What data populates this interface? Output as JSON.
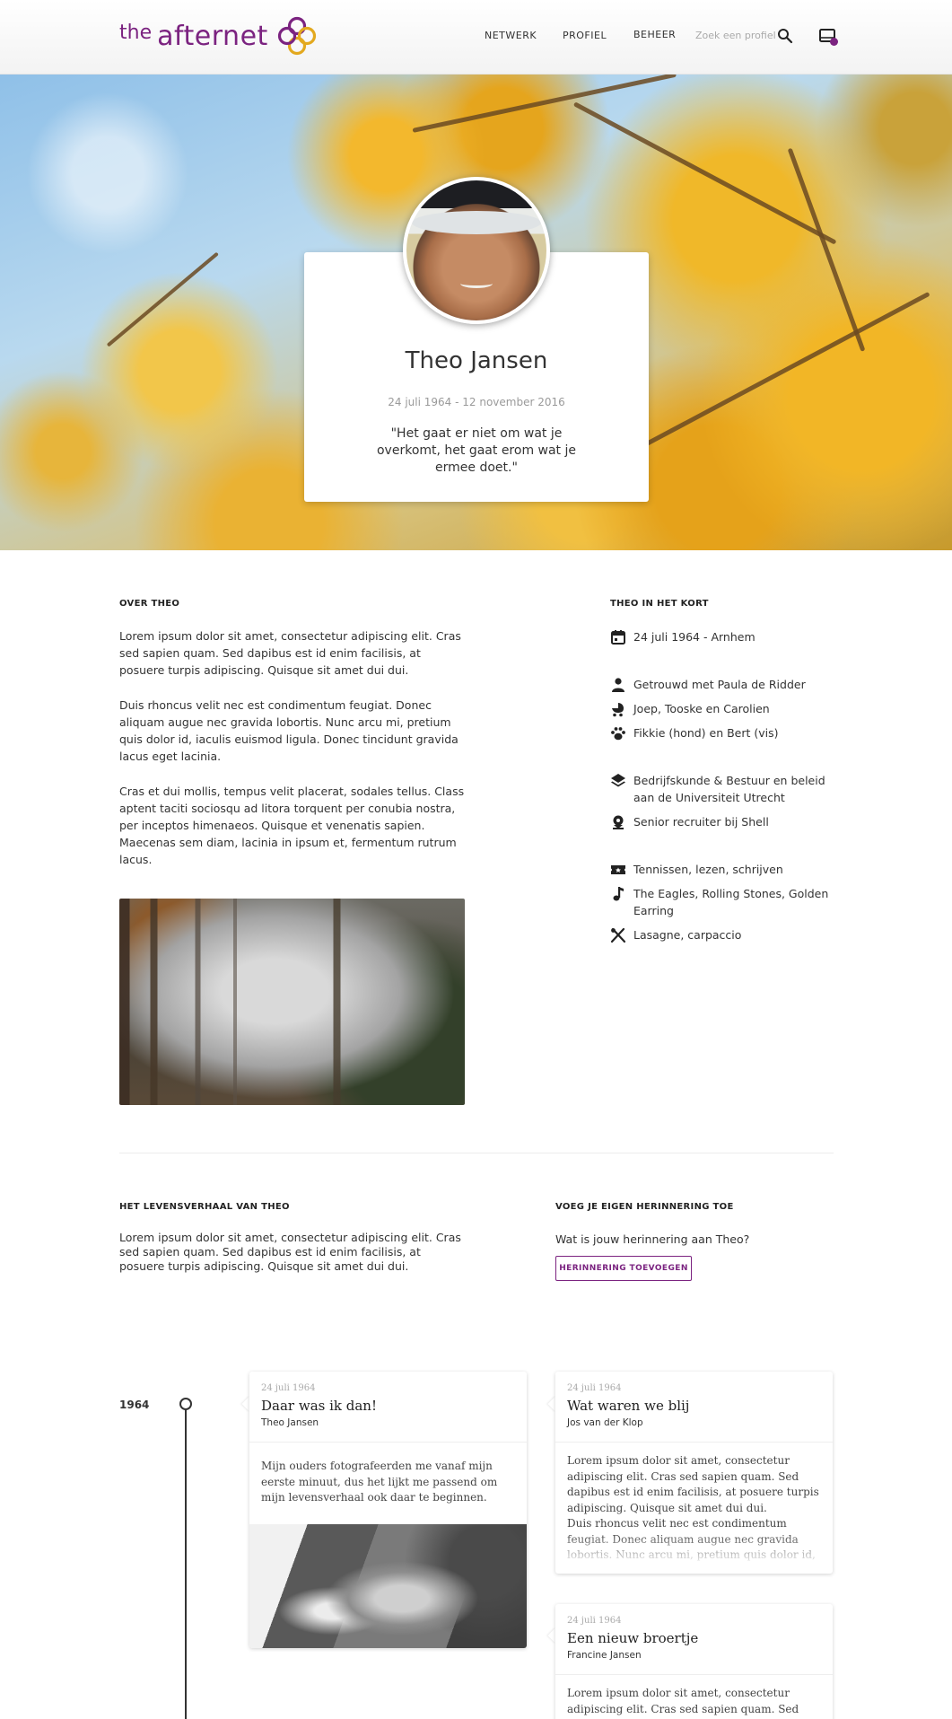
{
  "header": {
    "logo_the": "the",
    "logo_afternet": "afternet",
    "nav": [
      "NETWERK",
      "PROFIEL",
      "BEHEER"
    ],
    "search_placeholder": "Zoek een profiel",
    "brand_color": "#7b2380"
  },
  "profile": {
    "name": "Theo Jansen",
    "dates": "24 juli 1964 - 12 november 2016",
    "quote": "\"Het gaat er niet om wat je overkomt, het gaat erom wat je ermee doet.\""
  },
  "about": {
    "heading": "OVER THEO",
    "paragraphs": [
      "Lorem ipsum dolor sit amet, consectetur adipiscing elit. Cras sed sapien quam. Sed dapibus est id enim facilisis, at posuere turpis adipiscing. Quisque sit amet dui dui.",
      "Duis rhoncus velit nec est condimentum feugiat. Donec aliquam augue nec gravida lobortis. Nunc arcu mi, pretium quis dolor id, iaculis euismod ligula. Donec tincidunt gravida lacus eget lacinia.",
      "Cras et dui mollis, tempus velit placerat, sodales tellus. Class aptent taciti sociosqu ad litora torquent per conubia nostra, per inceptos himenaeos. Quisque et venenatis sapien. Maecenas sem diam, lacinia in ipsum et, fermentum rutrum lacus."
    ]
  },
  "kort": {
    "heading": "THEO IN HET KORT",
    "items": [
      {
        "icon": "calendar-icon",
        "text": "24 juli 1964 - Arnhem"
      },
      {
        "icon": "person-icon",
        "text": "Getrouwd met Paula de Ridder"
      },
      {
        "icon": "stroller-icon",
        "text": "Joep, Tooske en Carolien"
      },
      {
        "icon": "paw-icon",
        "text": "Fikkie (hond) en Bert (vis)"
      },
      {
        "icon": "layers-icon",
        "text": "Bedrijfskunde & Bestuur en beleid aan de Universiteit Utrecht"
      },
      {
        "icon": "work-badge-icon",
        "text": "Senior recruiter bij Shell"
      },
      {
        "icon": "ticket-icon",
        "text": "Tennissen, lezen, schrijven"
      },
      {
        "icon": "music-note-icon",
        "text": "The Eagles, Rolling Stones, Golden Earring"
      },
      {
        "icon": "cutlery-icon",
        "text": "Lasagne, carpaccio"
      }
    ]
  },
  "story": {
    "heading": "HET LEVENSVERHAAL VAN THEO",
    "text": "Lorem ipsum dolor sit amet, consectetur adipiscing elit. Cras sed sapien quam. Sed dapibus est id enim facilisis, at posuere turpis adipiscing. Quisque sit amet dui dui."
  },
  "memory": {
    "heading": "VOEG JE EIGEN HERINNERING TOE",
    "question": "Wat is jouw herinnering aan Theo?",
    "button": "HERINNERING TOEVOEGEN"
  },
  "timeline": {
    "year": "1964",
    "cards": [
      {
        "date": "24 juli 1964",
        "title": "Daar was ik dan!",
        "author": "Theo Jansen",
        "body": "Mijn ouders fotografeerden me vanaf mijn eerste minuut, dus het lijkt me passend om mijn levensverhaal ook daar te beginnen."
      },
      {
        "date": "24 juli 1964",
        "title": "Wat waren we blij",
        "author": "Jos van der Klop",
        "body": "Lorem ipsum dolor sit amet, consectetur adipiscing elit. Cras sed sapien quam. Sed dapibus est id enim facilisis, at posuere turpis adipiscing. Quisque sit amet dui dui.",
        "body2": "Duis rhoncus velit nec est condimentum feugiat. Donec aliquam augue nec gravida lobortis. Nunc arcu mi, pretium quis dolor id, iaculis euismod"
      },
      {
        "date": "24 juli 1964",
        "title": "Een nieuw broertje",
        "author": "Francine Jansen",
        "body": "Lorem ipsum dolor sit amet, consectetur adipiscing elit. Cras sed sapien quam. Sed"
      }
    ]
  }
}
